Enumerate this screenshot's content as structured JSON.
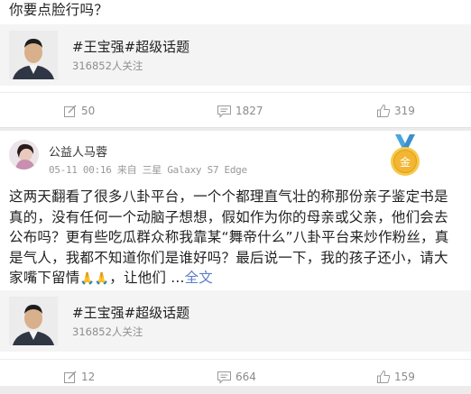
{
  "post1": {
    "text_tail": "你要点脸行吗？",
    "topic": {
      "title": "#王宝强#超级话题",
      "followers": "316852人关注"
    },
    "actions": {
      "repost": "50",
      "comment": "1827",
      "like": "319"
    }
  },
  "post2": {
    "username": "公益人马蓉",
    "meta": "05-11 00:16 来自 三星 Galaxy S7 Edge",
    "body": "这两天翻看了很多八卦平台，一个个都理直气壮的称那份亲子鉴定书是真的，没有任何一个动脑子想想，假如作为你的母亲或父亲，他们会去公布吗？更有些吃瓜群众称我靠某“舞帝什么”八卦平台来炒作粉丝，真是气人，我都不知道你们是谁好吗？最后说一下，我的孩子还小，请大家嘴下留情",
    "emoji": "🙏🙏",
    "body_end": "，让他们 ...",
    "more": "全文",
    "topic": {
      "title": "#王宝强#超级话题",
      "followers": "316852人关注"
    },
    "actions": {
      "repost": "12",
      "comment": "664",
      "like": "159"
    }
  },
  "icons": {
    "repost": "edit-icon",
    "comment": "comment-icon",
    "like": "thumbs-up-icon",
    "medal": "gold-medal-icon"
  },
  "colors": {
    "link": "#5d7fc8",
    "medal_ribbon": "#4aa6e0",
    "medal_gold": "#f2b632"
  }
}
